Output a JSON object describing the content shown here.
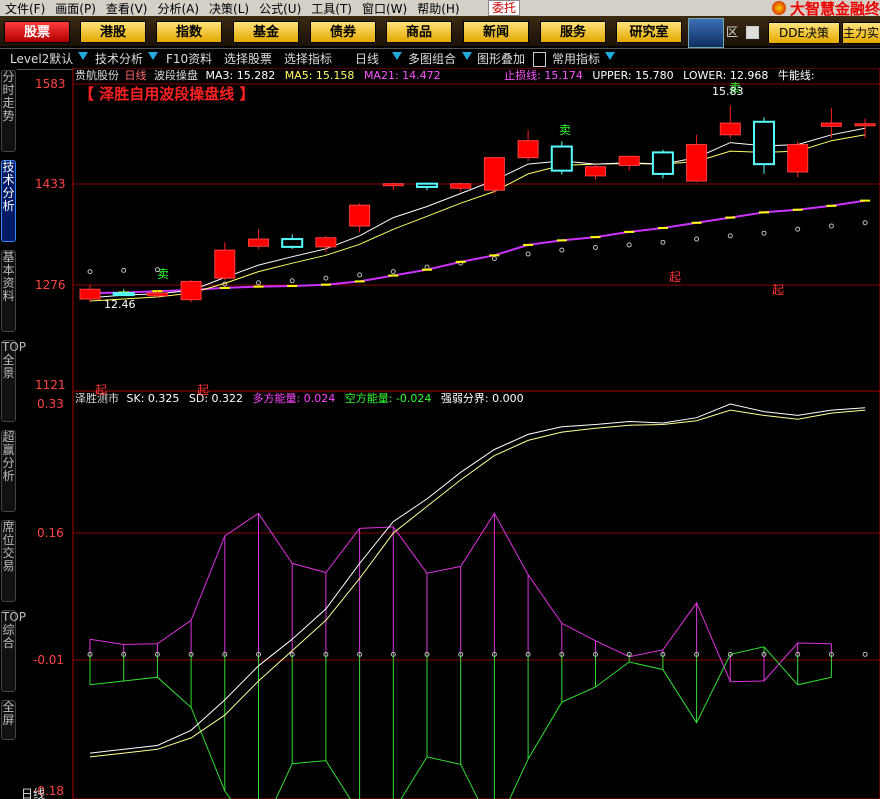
{
  "menubar": {
    "items": [
      "文件(F)",
      "画面(P)",
      "查看(V)",
      "分析(A)",
      "决策(L)",
      "公式(U)",
      "工具(T)",
      "窗口(W)",
      "帮助(H)"
    ],
    "weituo": "委托",
    "brand": "大智慧金融终"
  },
  "nav": {
    "buttons": [
      "股票",
      "港股",
      "指数",
      "基金",
      "债券",
      "商品",
      "新闻",
      "服务",
      "研究室"
    ],
    "area_label": "区",
    "dde_label": "DDE决策",
    "main_force_label": "主力实"
  },
  "toolbar": {
    "items": [
      "Level2默认",
      "技术分析",
      "F10资料",
      "选择股票",
      "选择指标",
      "日线",
      "多图组合",
      "图形叠加",
      "常用指标"
    ]
  },
  "sidebar": {
    "tabs": [
      "分时走势",
      "技术分析",
      "基本资料",
      "TOP全景",
      "超赢分析",
      "席位交易",
      "TOP综合",
      "全屏"
    ]
  },
  "main_panel": {
    "stock": "贵航股份",
    "period": "日线",
    "indicator": "波段操盘",
    "ma3": "MA3: 15.282",
    "ma5": "MA5: 15.158",
    "ma21": "MA21: 14.472",
    "stop": "止损线: 15.174",
    "upper": "UPPER: 15.780",
    "lower": "LOWER: 12.968",
    "energy": "牛能线:",
    "formula_title": "【 泽胜自用波段操盘线 】",
    "y_ticks": [
      "1583",
      "1433",
      "1276",
      "1121"
    ],
    "annotations": {
      "sell1": "卖",
      "sell2": "卖",
      "buy1": "卖",
      "qi1": "起",
      "qi2": "起",
      "qi3": "起",
      "qi4": "起",
      "high_price": "15.83",
      "low_price": "12.46"
    }
  },
  "sub_panel": {
    "name": "泽胜测市",
    "sk": "SK: 0.325",
    "sd": "SD: 0.322",
    "bull": "多方能量: 0.024",
    "bear": "空方能量: -0.024",
    "boundary": "强弱分界: 0.000",
    "y_ticks": [
      "0.33",
      "0.16",
      "-0.01",
      "-0.18"
    ]
  },
  "bottom_label": "日线",
  "colors": {
    "up": "#ff2020",
    "down": "#55ffff",
    "ma_white": "#ffffff",
    "ma_yellow": "#ffff66",
    "stop_line": "#ffff00",
    "support_line": "#cc33ff",
    "grid": "#880000",
    "bull": "#dd33dd",
    "bear": "#33dd33"
  },
  "chart_data": {
    "type": "candlestick",
    "price_scale": {
      "min": 1121,
      "max": 1583
    },
    "candles": [
      {
        "o": 1253,
        "h": 1275,
        "l": 1248,
        "c": 1268
      },
      {
        "o": 1262,
        "h": 1268,
        "l": 1258,
        "c": 1261
      },
      {
        "o": 1258,
        "h": 1265,
        "l": 1255,
        "c": 1262
      },
      {
        "o": 1252,
        "h": 1282,
        "l": 1248,
        "c": 1280
      },
      {
        "o": 1285,
        "h": 1340,
        "l": 1282,
        "c": 1328
      },
      {
        "o": 1334,
        "h": 1360,
        "l": 1330,
        "c": 1345
      },
      {
        "o": 1345,
        "h": 1352,
        "l": 1330,
        "c": 1333
      },
      {
        "o": 1333,
        "h": 1350,
        "l": 1325,
        "c": 1347
      },
      {
        "o": 1365,
        "h": 1400,
        "l": 1355,
        "c": 1397
      },
      {
        "o": 1427,
        "h": 1432,
        "l": 1420,
        "c": 1430
      },
      {
        "o": 1430,
        "h": 1432,
        "l": 1420,
        "c": 1425
      },
      {
        "o": 1423,
        "h": 1432,
        "l": 1418,
        "c": 1430
      },
      {
        "o": 1420,
        "h": 1470,
        "l": 1415,
        "c": 1470
      },
      {
        "o": 1470,
        "h": 1512,
        "l": 1465,
        "c": 1496
      },
      {
        "o": 1487,
        "h": 1495,
        "l": 1444,
        "c": 1450
      },
      {
        "o": 1442,
        "h": 1460,
        "l": 1436,
        "c": 1456
      },
      {
        "o": 1458,
        "h": 1472,
        "l": 1450,
        "c": 1472
      },
      {
        "o": 1478,
        "h": 1482,
        "l": 1438,
        "c": 1445
      },
      {
        "o": 1434,
        "h": 1505,
        "l": 1432,
        "c": 1490
      },
      {
        "o": 1505,
        "h": 1550,
        "l": 1500,
        "c": 1523
      },
      {
        "o": 1525,
        "h": 1532,
        "l": 1445,
        "c": 1460
      },
      {
        "o": 1448,
        "h": 1495,
        "l": 1440,
        "c": 1490
      },
      {
        "o": 1518,
        "h": 1546,
        "l": 1500,
        "c": 1523
      },
      {
        "o": 1520,
        "h": 1530,
        "l": 1500,
        "c": 1522
      }
    ],
    "ma_white": [
      1255,
      1259,
      1261,
      1266,
      1286,
      1305,
      1318,
      1330,
      1350,
      1378,
      1395,
      1415,
      1435,
      1460,
      1465,
      1460,
      1462,
      1460,
      1470,
      1493,
      1488,
      1490,
      1505,
      1515
    ],
    "ma_yellow": [
      1250,
      1253,
      1256,
      1262,
      1277,
      1295,
      1308,
      1320,
      1337,
      1360,
      1380,
      1400,
      1418,
      1445,
      1458,
      1460,
      1461,
      1460,
      1464,
      1480,
      1478,
      1480,
      1496,
      1505
    ],
    "stop_line": [
      1262,
      1263,
      1265,
      1267,
      1270,
      1272,
      1273,
      1275,
      1280,
      1289,
      1298,
      1310,
      1320,
      1336,
      1343,
      1348,
      1356,
      1362,
      1370,
      1378,
      1386,
      1390,
      1396,
      1404
    ],
    "lower_dots": [
      1295,
      1297,
      1298,
      1273,
      1276,
      1278,
      1281,
      1285,
      1290,
      1295,
      1302,
      1308,
      1315,
      1322,
      1328,
      1332,
      1336,
      1340,
      1345,
      1350,
      1354,
      1360,
      1365,
      1370
    ],
    "sub_scale": {
      "min": -0.18,
      "max": 0.33
    },
    "sk": [
      -0.13,
      -0.125,
      -0.12,
      -0.1,
      -0.06,
      -0.015,
      0.02,
      0.06,
      0.12,
      0.175,
      0.205,
      0.24,
      0.27,
      0.29,
      0.3,
      0.303,
      0.307,
      0.305,
      0.312,
      0.33,
      0.32,
      0.315,
      0.322,
      0.325
    ],
    "sd": [
      -0.135,
      -0.13,
      -0.125,
      -0.11,
      -0.08,
      -0.035,
      0.005,
      0.045,
      0.1,
      0.16,
      0.195,
      0.23,
      0.262,
      0.282,
      0.293,
      0.298,
      0.302,
      0.303,
      0.308,
      0.322,
      0.315,
      0.31,
      0.318,
      0.322
    ],
    "bull": [
      0.02,
      0.013,
      0.014,
      0.045,
      0.156,
      0.186,
      0.12,
      0.108,
      0.166,
      0.168,
      0.107,
      0.116,
      0.186,
      0.105,
      0.041,
      0.018,
      -0.003,
      0.006,
      0.068,
      -0.036,
      -0.035,
      0.015,
      0.014
    ],
    "bear": [
      -0.04,
      -0.035,
      -0.03,
      -0.07,
      -0.18,
      -0.24,
      -0.144,
      -0.14,
      -0.21,
      -0.207,
      -0.135,
      -0.145,
      -0.234,
      -0.138,
      -0.063,
      -0.043,
      -0.01,
      -0.02,
      -0.09,
      0.0,
      0.01,
      -0.04,
      -0.03
    ]
  }
}
